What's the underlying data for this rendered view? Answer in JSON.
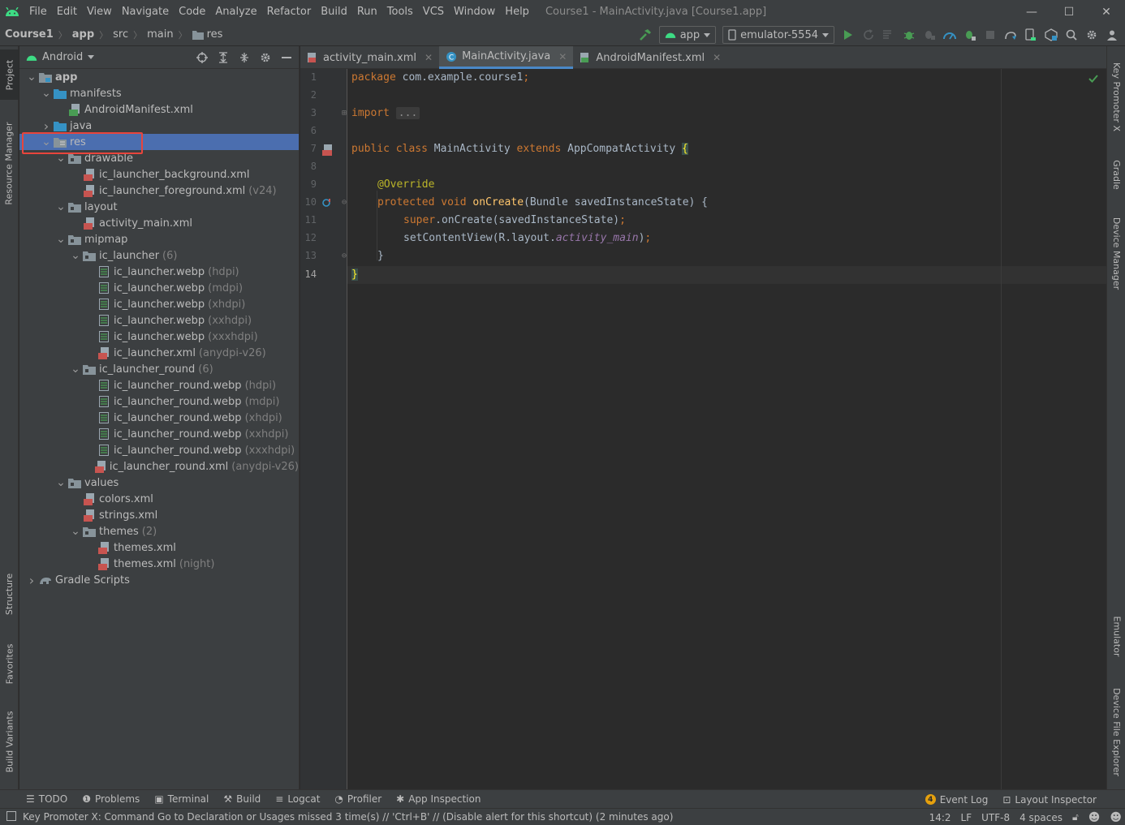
{
  "menubar": {
    "items": [
      "File",
      "Edit",
      "View",
      "Navigate",
      "Code",
      "Analyze",
      "Refactor",
      "Build",
      "Run",
      "Tools",
      "VCS",
      "Window",
      "Help"
    ],
    "window_title": "Course1 - MainActivity.java [Course1.app]",
    "minimize": "—",
    "maximize": "☐",
    "close": "✕"
  },
  "breadcrumb": {
    "items": [
      "Course1",
      "app",
      "src",
      "main",
      "res"
    ]
  },
  "toolbar": {
    "config_label": "app",
    "device_label": "emulator-5554"
  },
  "project_panel": {
    "view_label": "Android"
  },
  "tree": [
    {
      "label": "app",
      "suffix": ""
    },
    {
      "label": "manifests",
      "suffix": ""
    },
    {
      "label": "AndroidManifest.xml",
      "suffix": ""
    },
    {
      "label": "java",
      "suffix": ""
    },
    {
      "label": "res",
      "suffix": ""
    },
    {
      "label": "drawable",
      "suffix": ""
    },
    {
      "label": "ic_launcher_background.xml",
      "suffix": ""
    },
    {
      "label": "ic_launcher_foreground.xml",
      "suffix": "(v24)"
    },
    {
      "label": "layout",
      "suffix": ""
    },
    {
      "label": "activity_main.xml",
      "suffix": ""
    },
    {
      "label": "mipmap",
      "suffix": ""
    },
    {
      "label": "ic_launcher",
      "suffix": "(6)"
    },
    {
      "label": "ic_launcher.webp",
      "suffix": "(hdpi)"
    },
    {
      "label": "ic_launcher.webp",
      "suffix": "(mdpi)"
    },
    {
      "label": "ic_launcher.webp",
      "suffix": "(xhdpi)"
    },
    {
      "label": "ic_launcher.webp",
      "suffix": "(xxhdpi)"
    },
    {
      "label": "ic_launcher.webp",
      "suffix": "(xxxhdpi)"
    },
    {
      "label": "ic_launcher.xml",
      "suffix": "(anydpi-v26)"
    },
    {
      "label": "ic_launcher_round",
      "suffix": "(6)"
    },
    {
      "label": "ic_launcher_round.webp",
      "suffix": "(hdpi)"
    },
    {
      "label": "ic_launcher_round.webp",
      "suffix": "(mdpi)"
    },
    {
      "label": "ic_launcher_round.webp",
      "suffix": "(xhdpi)"
    },
    {
      "label": "ic_launcher_round.webp",
      "suffix": "(xxhdpi)"
    },
    {
      "label": "ic_launcher_round.webp",
      "suffix": "(xxxhdpi)"
    },
    {
      "label": "ic_launcher_round.xml",
      "suffix": "(anydpi-v26)"
    },
    {
      "label": "values",
      "suffix": ""
    },
    {
      "label": "colors.xml",
      "suffix": ""
    },
    {
      "label": "strings.xml",
      "suffix": ""
    },
    {
      "label": "themes",
      "suffix": "(2)"
    },
    {
      "label": "themes.xml",
      "suffix": ""
    },
    {
      "label": "themes.xml",
      "suffix": "(night)"
    },
    {
      "label": "Gradle Scripts",
      "suffix": ""
    }
  ],
  "editor_tabs": [
    "activity_main.xml",
    "MainActivity.java",
    "AndroidManifest.xml"
  ],
  "editor": {
    "line_numbers": [
      "1",
      "2",
      "3",
      "6",
      "7",
      "8",
      "9",
      "10",
      "11",
      "12",
      "13",
      "14"
    ],
    "code": {
      "l1_kw": "package",
      "l1_rest": " com.example.course1",
      "l1_semi": ";",
      "l3_kw": "import",
      "l3_fold": "...",
      "l7_kw": "public class",
      "l7_name": " MainActivity ",
      "l7_ext": "extends",
      "l7_base": " AppCompatActivity ",
      "l7_brace": "{",
      "l9_ann": "@Override",
      "l10_kw": "protected void",
      "l10_fn": "onCreate",
      "l10_rest": "(Bundle savedInstanceState) {",
      "l11_kw": "super",
      "l11_rest": ".onCreate(savedInstanceState)",
      "l11_semi": ";",
      "l12_pre": "setContentView(R.layout.",
      "l12_it": "activity_main",
      "l12_post": ")",
      "l12_semi": ";",
      "l13": "}",
      "l14": "}"
    }
  },
  "left_stripe": {
    "project": "Project",
    "resource_manager": "Resource Manager",
    "structure": "Structure",
    "favorites": "Favorites",
    "build_variants": "Build Variants"
  },
  "right_stripe": {
    "key_promoter": "Key Promoter X",
    "gradle": "Gradle",
    "device_manager": "Device Manager",
    "emulator": "Emulator",
    "device_file_explorer": "Device File Explorer"
  },
  "bottom_tabs": [
    "TODO",
    "Problems",
    "Terminal",
    "Build",
    "Logcat",
    "Profiler",
    "App Inspection"
  ],
  "bottom_right": {
    "event_log": "Event Log",
    "event_count": "4",
    "layout_inspector": "Layout Inspector"
  },
  "status": {
    "message": "Key Promoter X: Command Go to Declaration or Usages missed 3 time(s) // 'Ctrl+B' // (Disable alert for this shortcut) (2 minutes ago)",
    "position": "14:2",
    "line_sep": "LF",
    "encoding": "UTF-8",
    "indent": "4 spaces"
  },
  "colors": {
    "selection": "#4b6eaf",
    "highlight_box": "#e8453c",
    "android_green": "#3ddc84"
  }
}
